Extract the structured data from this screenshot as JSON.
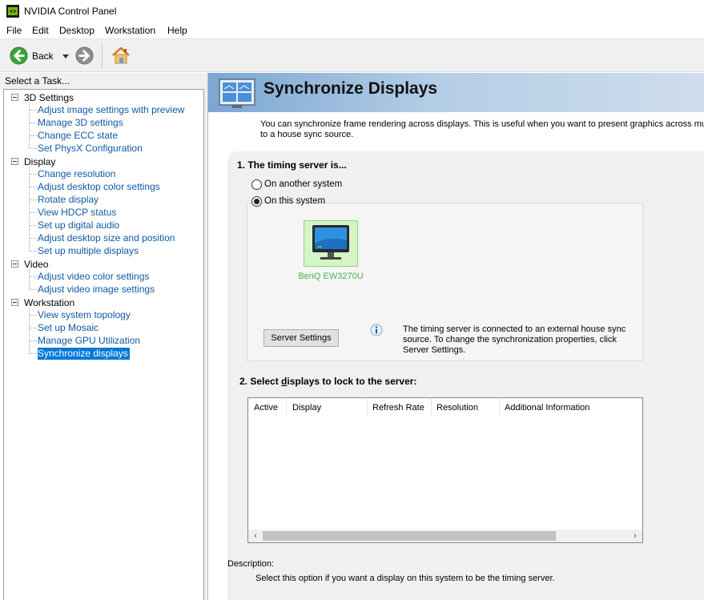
{
  "window": {
    "title": "NVIDIA Control Panel"
  },
  "menu": {
    "items": [
      "File",
      "Edit",
      "Desktop",
      "Workstation",
      "Help"
    ]
  },
  "toolbar": {
    "back_label": "Back"
  },
  "task_pane": {
    "header": "Select a Task...",
    "categories": [
      {
        "label": "3D Settings",
        "items": [
          "Adjust image settings with preview",
          "Manage 3D settings",
          "Change ECC state",
          "Set PhysX Configuration"
        ]
      },
      {
        "label": "Display",
        "items": [
          "Change resolution",
          "Adjust desktop color settings",
          "Rotate display",
          "View HDCP status",
          "Set up digital audio",
          "Adjust desktop size and position",
          "Set up multiple displays"
        ]
      },
      {
        "label": "Video",
        "items": [
          "Adjust video color settings",
          "Adjust video image settings"
        ]
      },
      {
        "label": "Workstation",
        "items": [
          "View system topology",
          "Set up Mosaic",
          "Manage GPU Utilization",
          "Synchronize displays"
        ]
      }
    ],
    "selected_item": "Synchronize displays"
  },
  "page": {
    "title": "Synchronize Displays",
    "intro_line1": "You can synchronize frame rendering across displays. This is useful when you want to present graphics across multiple",
    "intro_line2": "to a house sync source.",
    "section1_title": "1. The timing server is...",
    "radio_another": "On another system",
    "radio_this": "On this system",
    "selected_radio": "On this system",
    "monitor_name": "BenQ EW3270U",
    "server_settings_button": "Server Settings",
    "info_text": "The timing server is connected to an external house sync source. To change the synchronization properties, click Server Settings.",
    "section2_prefix": "2. Select ",
    "section2_underlined": "d",
    "section2_suffix": "isplays to lock to the server:",
    "table_columns": [
      "Active",
      "Display",
      "Refresh Rate",
      "Resolution",
      "Additional Information"
    ],
    "description_label": "Description:",
    "description_text": "Select this option if you want a display on this system to be the timing server."
  },
  "colors": {
    "link": "#0f5aa3",
    "selected_bg": "#0078d7",
    "monitor_label": "#4caf50",
    "nvidia_green": "#76b900"
  }
}
